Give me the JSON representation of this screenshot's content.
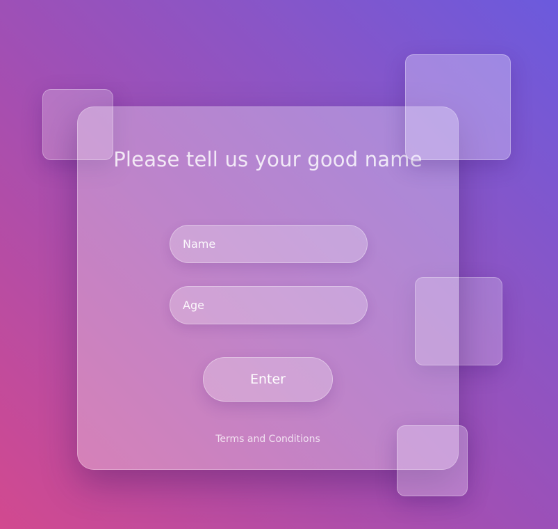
{
  "form": {
    "title": "Please tell us your good name",
    "name_placeholder": "Name",
    "age_placeholder": "Age",
    "submit_label": "Enter",
    "terms_link": "Terms and Conditions"
  },
  "colors": {
    "background_start": "#d2498f",
    "background_end": "#6b5add",
    "text": "#ffffff"
  }
}
